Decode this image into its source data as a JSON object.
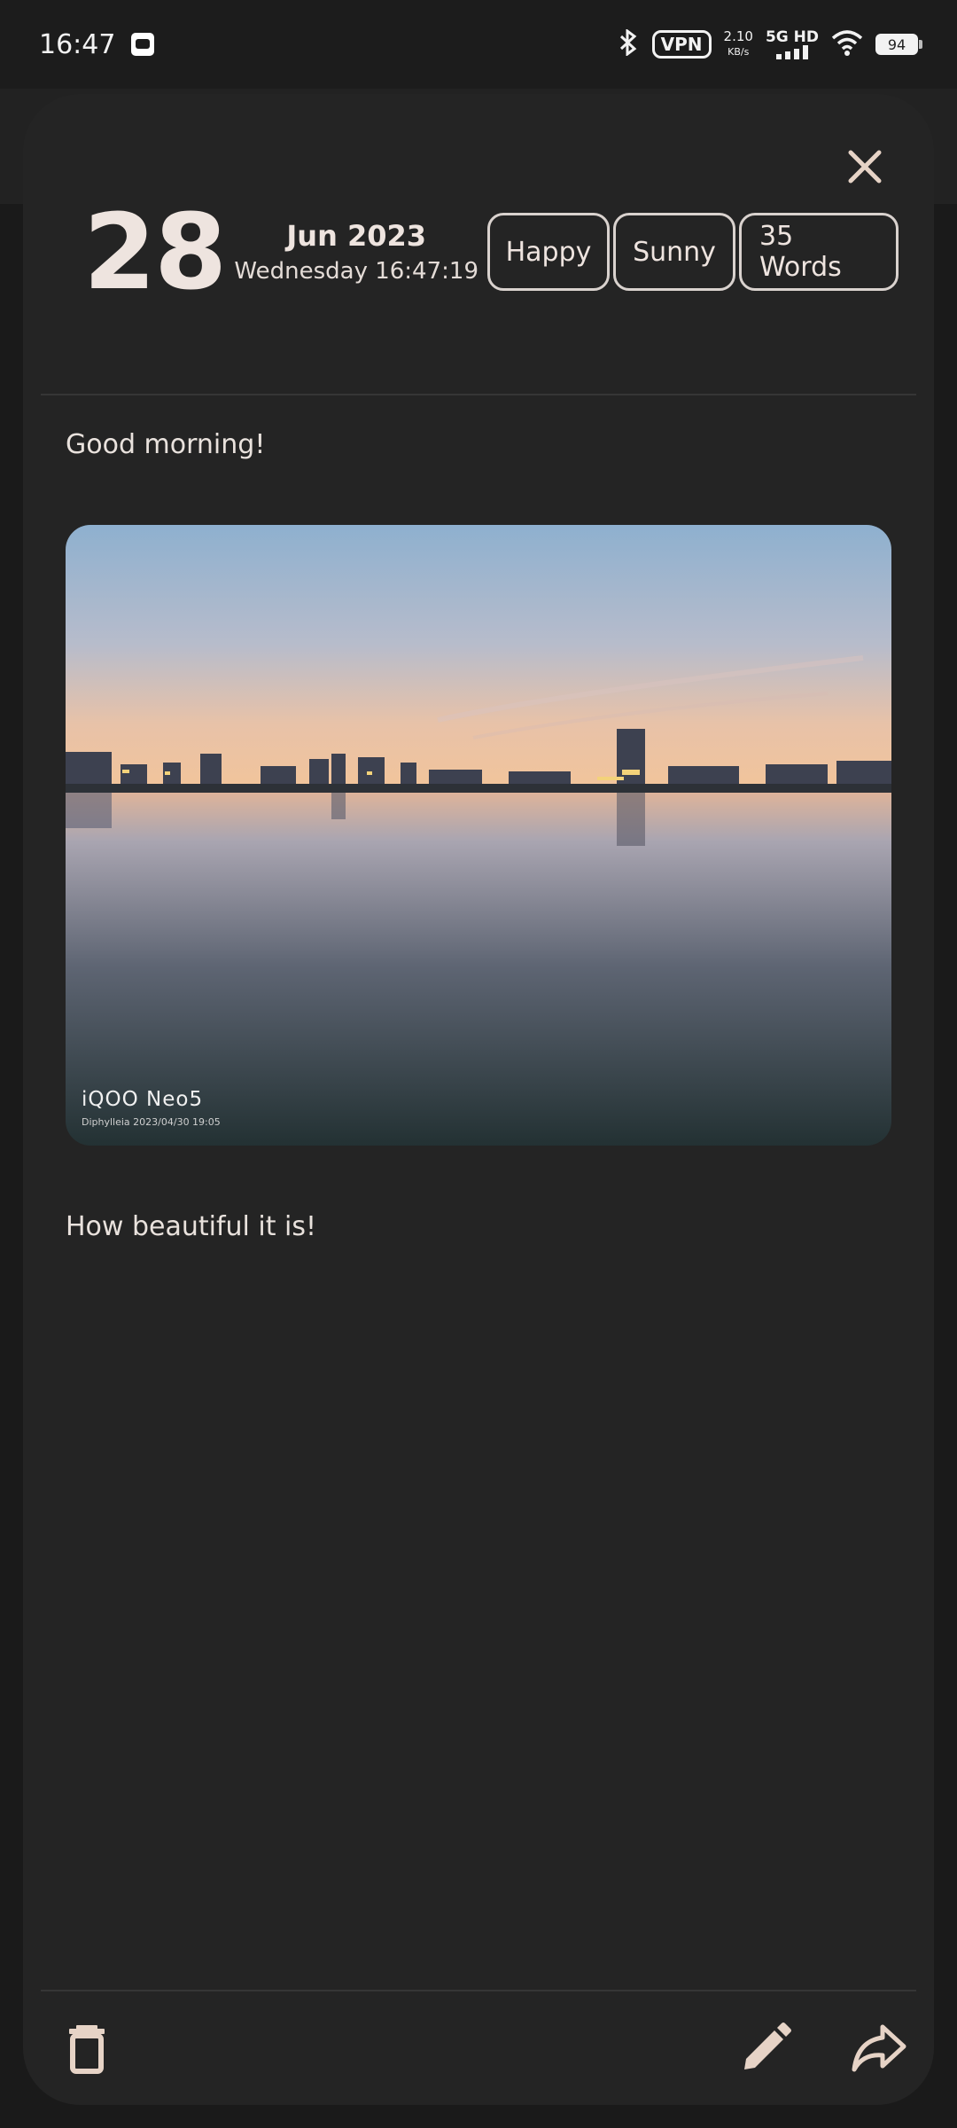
{
  "status_bar": {
    "time": "16:47",
    "vpn": "VPN",
    "speed_value": "2.10",
    "speed_unit": "KB/s",
    "network": "5G HD",
    "battery": "94"
  },
  "entry": {
    "day": "28",
    "month_year": "Jun 2023",
    "weekday_time": "Wednesday 16:47:19",
    "tags": [
      "Happy",
      "Sunny",
      "35 Words"
    ],
    "paragraph_1": "Good morning!",
    "photo_watermark_title": "iQOO Neo5",
    "photo_watermark_sub": "Diphylleia  2023/04/30 19:05",
    "paragraph_2": "How beautiful it is!"
  },
  "icons": {
    "close": "close-icon",
    "delete": "trash-icon",
    "edit": "pencil-icon",
    "share": "share-icon"
  },
  "colors": {
    "sheet_bg": "#242424",
    "text": "#e9e2dd",
    "icon_accent": "#e6d3c6"
  }
}
